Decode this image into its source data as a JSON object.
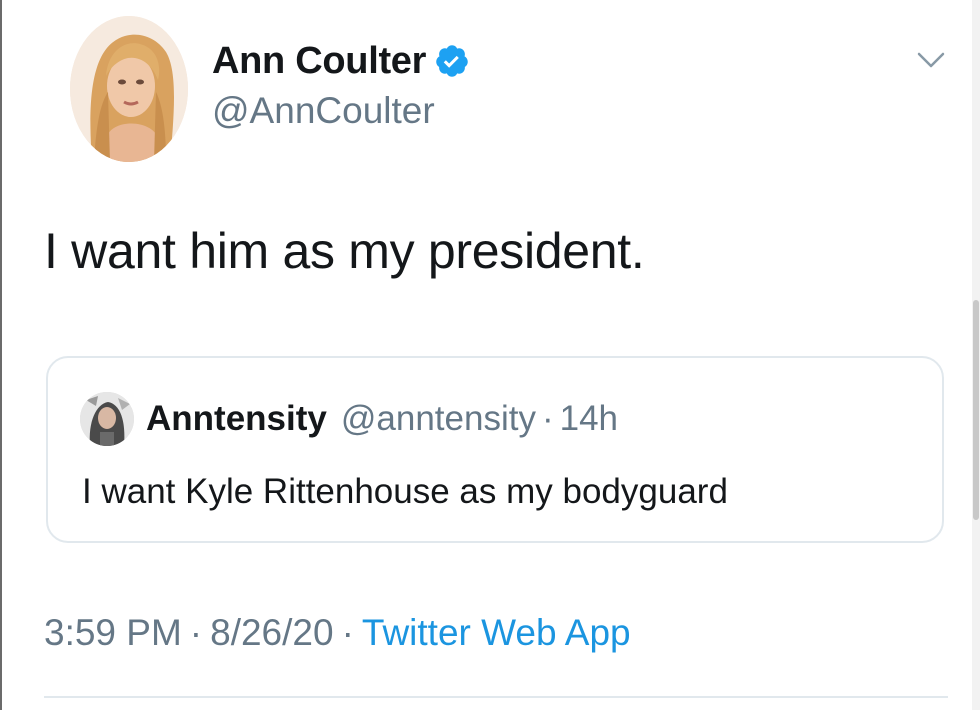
{
  "tweet": {
    "author_name": "Ann Coulter",
    "author_handle": "@AnnCoulter",
    "verified": true,
    "text": "I want him as my president.",
    "timestamp_time": "3:59 PM",
    "timestamp_date": "8/26/20",
    "source": "Twitter Web App",
    "separator": "·"
  },
  "quoted_tweet": {
    "author_name": "Anntensity",
    "author_handle": "@anntensity",
    "separator": "·",
    "time_ago": "14h",
    "text": "I want Kyle Rittenhouse as my bodyguard"
  },
  "icons": {
    "verified": "verified-badge-icon",
    "caret": "chevron-down-icon"
  },
  "colors": {
    "primary_text": "#14171a",
    "secondary_text": "#657786",
    "link": "#1b95e0",
    "verified_blue": "#1da1f2",
    "border": "#e1e8ed"
  }
}
